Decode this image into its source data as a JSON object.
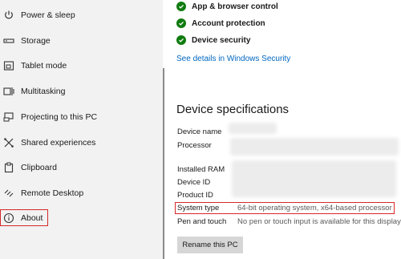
{
  "sidebar": {
    "items": [
      {
        "label": "Power & sleep",
        "icon": "power-icon"
      },
      {
        "label": "Storage",
        "icon": "storage-icon"
      },
      {
        "label": "Tablet mode",
        "icon": "tablet-mode-icon"
      },
      {
        "label": "Multitasking",
        "icon": "multitasking-icon"
      },
      {
        "label": "Projecting to this PC",
        "icon": "projecting-icon"
      },
      {
        "label": "Shared experiences",
        "icon": "shared-experiences-icon"
      },
      {
        "label": "Clipboard",
        "icon": "clipboard-icon"
      },
      {
        "label": "Remote Desktop",
        "icon": "remote-desktop-icon"
      },
      {
        "label": "About",
        "icon": "info-icon",
        "selected": true
      }
    ]
  },
  "security": {
    "items": [
      {
        "label": "App & browser control"
      },
      {
        "label": "Account protection"
      },
      {
        "label": "Device security"
      }
    ],
    "link": "See details in Windows Security",
    "status_color": "#107c10"
  },
  "specs": {
    "heading": "Device specifications",
    "rows": [
      {
        "label": "Device name",
        "value": ""
      },
      {
        "label": "Processor",
        "value": ""
      },
      {
        "label": "Installed RAM",
        "value": ""
      },
      {
        "label": "Device ID",
        "value": ""
      },
      {
        "label": "Product ID",
        "value": ""
      },
      {
        "label": "System type",
        "value": "64-bit operating system, x64-based processor"
      },
      {
        "label": "Pen and touch",
        "value": "No pen or touch input is available for this display"
      }
    ],
    "rename_button": "Rename this PC"
  },
  "colors": {
    "accent": "#0067c0",
    "highlight": "#d62828"
  }
}
